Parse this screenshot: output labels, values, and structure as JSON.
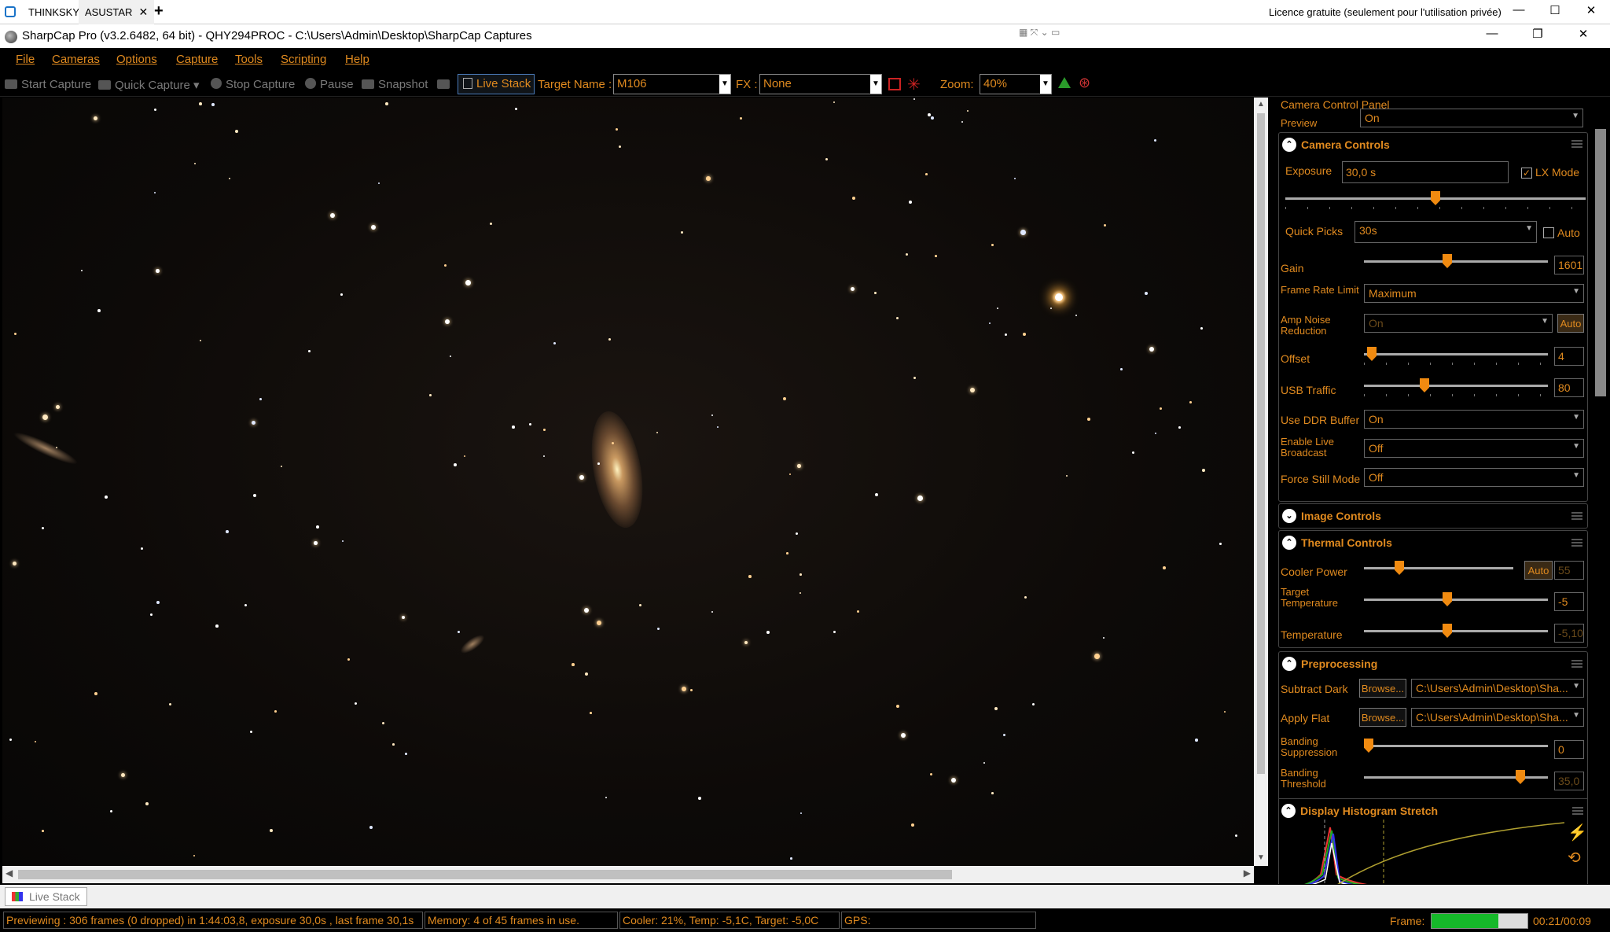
{
  "browser_tabs": [
    {
      "label": "THINKSKY"
    },
    {
      "label": "ASUSTAR",
      "close": "✕"
    }
  ],
  "new_tab": "+",
  "licence_text": "Licence gratuite (seulement pour l'utilisation privée)",
  "window_title": "SharpCap Pro (v3.2.6482, 64 bit) - QHY294PROC - C:\\Users\\Admin\\Desktop\\SharpCap Captures",
  "menu": [
    "File",
    "Cameras",
    "Options",
    "Capture",
    "Tools",
    "Scripting",
    "Help"
  ],
  "toolbar": {
    "start_capture": "Start Capture",
    "quick_capture": "Quick Capture",
    "stop_capture": "Stop Capture",
    "pause": "Pause",
    "snapshot": "Snapshot",
    "live_stack": "Live Stack",
    "target_label": "Target Name :",
    "target_value": "M106",
    "fx_label": "FX :",
    "fx_value": "None",
    "zoom_label": "Zoom:",
    "zoom_value": "40%"
  },
  "panel": {
    "title": "Camera Control Panel",
    "preview_label": "Preview",
    "preview_value": "On",
    "camera_controls": {
      "heading": "Camera Controls",
      "exposure_label": "Exposure",
      "exposure_value": "30,0 s",
      "lx_mode_label": "LX Mode",
      "lx_mode_checked": "✓",
      "exposure_slider": 0.5,
      "quick_picks_label": "Quick Picks",
      "quick_picks_value": "30s",
      "auto_label": "Auto",
      "gain_label": "Gain",
      "gain_value": "1601",
      "gain_slider": 0.45,
      "frame_rate_label": "Frame Rate Limit",
      "frame_rate_value": "Maximum",
      "amp_noise_label": "Amp Noise Reduction",
      "amp_noise_value": "On",
      "amp_noise_auto": "Auto",
      "offset_label": "Offset",
      "offset_value": "4",
      "offset_slider": 0.02,
      "usb_label": "USB Traffic",
      "usb_value": "80",
      "usb_slider": 0.32,
      "ddr_label": "Use DDR Buffer",
      "ddr_value": "On",
      "broadcast_label": "Enable Live Broadcast",
      "broadcast_value": "Off",
      "still_label": "Force Still Mode",
      "still_value": "Off"
    },
    "image_controls": {
      "heading": "Image Controls"
    },
    "thermal_controls": {
      "heading": "Thermal Controls",
      "cooler_label": "Cooler Power",
      "cooler_auto": "Auto",
      "cooler_value": "55",
      "cooler_slider": 0.22,
      "target_temp_label": "Target Temperature",
      "target_temp_value": "-5",
      "target_temp_slider": 0.45,
      "temp_label": "Temperature",
      "temp_value": "-5,10",
      "temp_slider": 0.45
    },
    "preprocessing": {
      "heading": "Preprocessing",
      "dark_label": "Subtract Dark",
      "dark_browse": "Browse...",
      "dark_path": "C:\\Users\\Admin\\Desktop\\Sha...",
      "flat_label": "Apply Flat",
      "flat_browse": "Browse...",
      "flat_path": "C:\\Users\\Admin\\Desktop\\Sha...",
      "banding_supp_label": "Banding Suppression",
      "banding_supp_value": "0",
      "banding_supp_slider": 0.0,
      "banding_thr_label": "Banding Threshold",
      "banding_thr_value": "35,0",
      "banding_thr_slider": 0.87
    },
    "histogram": {
      "heading": "Display Histogram Stretch"
    }
  },
  "bottom_tab": "Live Stack",
  "status": {
    "preview": "Previewing : 306 frames (0 dropped) in 1:44:03,8, exposure 30,0s , last frame 30,1s",
    "memory": "Memory: 4 of 45 frames in use.",
    "cooler": "Cooler: 21%, Temp: -5,1C, Target: -5,0C",
    "gps": "GPS:",
    "frame_label": "Frame:",
    "frame_progress": 0.7,
    "timer": "00:21/00:09"
  },
  "colors": {
    "accent": "#e08a1f",
    "knob": "#f08a10",
    "progress": "#16b82a"
  },
  "icons": [
    "minimize-icon",
    "maximize-icon",
    "close-icon",
    "pin-icon",
    "chevron-up-icon",
    "chevron-down-icon",
    "hamburger-icon"
  ]
}
